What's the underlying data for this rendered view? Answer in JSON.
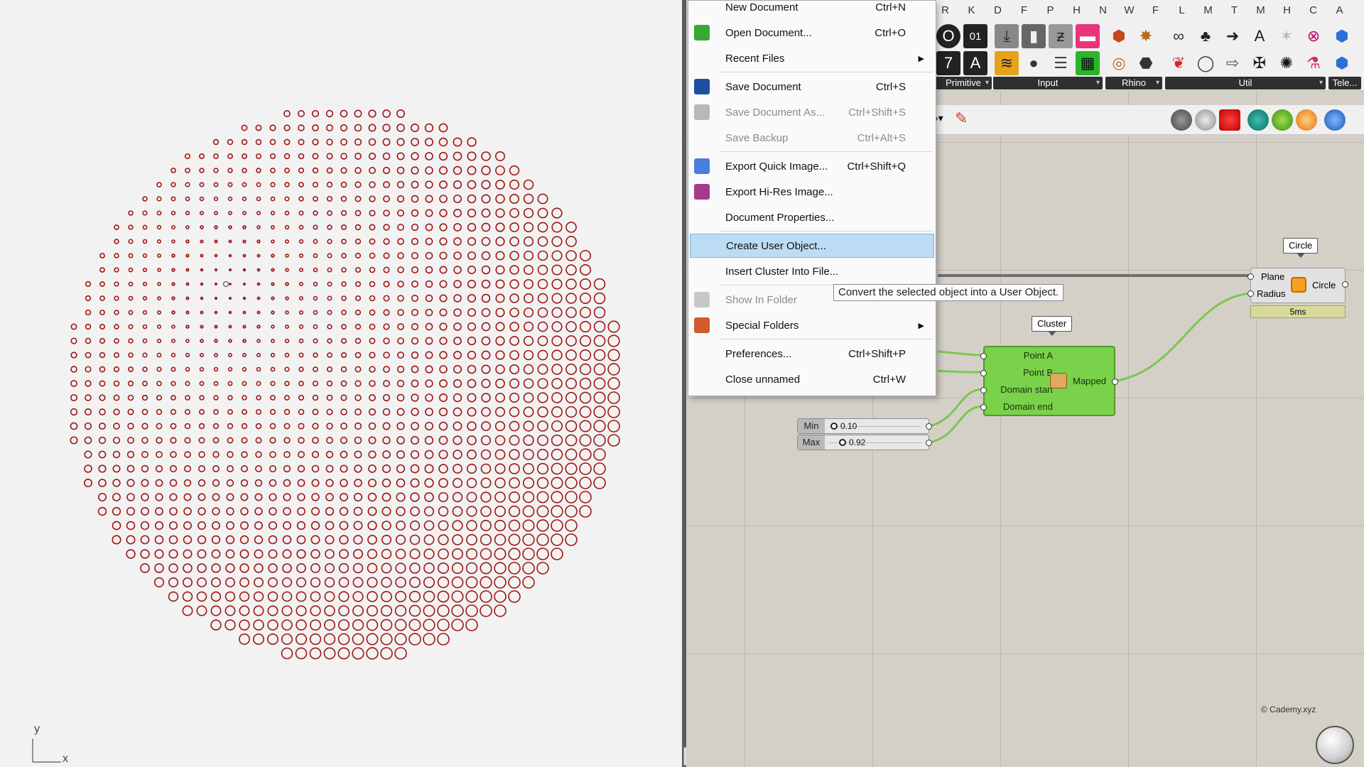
{
  "viewport": {
    "axis_y": "y",
    "axis_x": "x",
    "circle_color": "#a01515"
  },
  "file_menu": {
    "items": [
      {
        "label": "New Document",
        "shortcut": "Ctrl+N",
        "disabled": false
      },
      {
        "label": "Open Document...",
        "shortcut": "Ctrl+O",
        "disabled": false
      },
      {
        "label": "Recent Files",
        "shortcut": "",
        "submenu": true,
        "disabled": false
      },
      {
        "label": "Save Document",
        "shortcut": "Ctrl+S",
        "disabled": false
      },
      {
        "label": "Save Document As...",
        "shortcut": "Ctrl+Shift+S",
        "disabled": true
      },
      {
        "label": "Save Backup",
        "shortcut": "Ctrl+Alt+S",
        "disabled": true
      },
      {
        "label": "Export Quick Image...",
        "shortcut": "Ctrl+Shift+Q",
        "disabled": false
      },
      {
        "label": "Export Hi-Res Image...",
        "shortcut": "",
        "disabled": false
      },
      {
        "label": "Document Properties...",
        "shortcut": "",
        "disabled": false
      },
      {
        "label": "Create User Object...",
        "shortcut": "",
        "disabled": false,
        "highlighted": true
      },
      {
        "label": "Insert Cluster Into File...",
        "shortcut": "",
        "disabled": false
      },
      {
        "label": "Show In Folder",
        "shortcut": "",
        "disabled": true
      },
      {
        "label": "Special Folders",
        "shortcut": "",
        "submenu": true,
        "disabled": false
      },
      {
        "label": "Preferences...",
        "shortcut": "Ctrl+Shift+P",
        "disabled": false
      },
      {
        "label": "Close unnamed",
        "shortcut": "Ctrl+W",
        "disabled": false
      }
    ],
    "submenu_arrow": "▶"
  },
  "tooltip": "Convert the selected object into a User Object.",
  "ribbon": {
    "tab_letters": [
      "R",
      "K",
      "D",
      "F",
      "P",
      "H",
      "N",
      "W",
      "F",
      "L",
      "M",
      "T",
      "M",
      "H",
      "C",
      "A"
    ],
    "panels": [
      {
        "name": "Primitive"
      },
      {
        "name": "Input"
      },
      {
        "name": "Rhino"
      },
      {
        "name": "Util"
      },
      {
        "name": "Tele..."
      }
    ],
    "pin": "▾"
  },
  "canvas": {
    "cluster": {
      "bubble": "Cluster",
      "inputs": [
        "Point A",
        "Point B",
        "Domain start",
        "Domain end"
      ],
      "output": "Mapped",
      "color": "#79d24a"
    },
    "circle": {
      "bubble": "Circle",
      "inputs": [
        "Plane",
        "Radius"
      ],
      "output": "Circle",
      "status": "5ms"
    },
    "sliders": [
      {
        "label": "Min",
        "value": "0.10"
      },
      {
        "label": "Max",
        "value": "0.92"
      }
    ],
    "copyright": "© Cademy.xyz"
  }
}
